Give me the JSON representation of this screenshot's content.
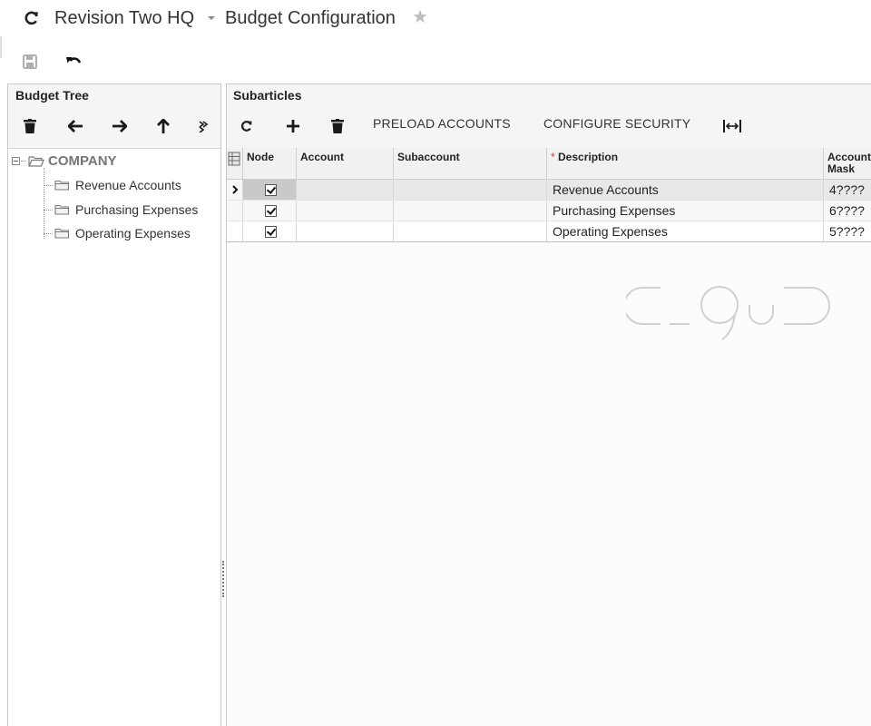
{
  "header": {
    "company": "Revision Two HQ",
    "screen_title": "Budget Configuration",
    "icons": [
      "refresh-icon",
      "dropdown-caret-icon",
      "star-icon",
      "save-icon",
      "undo-icon"
    ]
  },
  "budget_tree": {
    "title": "Budget Tree",
    "toolbar_icons": [
      "trash-icon",
      "arrow-left-icon",
      "arrow-right-icon",
      "arrow-up-icon",
      "more-icon"
    ],
    "root": "COMPANY",
    "children": [
      "Revenue Accounts",
      "Purchasing Expenses",
      "Operating Expenses"
    ]
  },
  "subarticles": {
    "title": "Subarticles",
    "toolbar": {
      "icons": [
        "refresh-icon",
        "add-icon",
        "trash-icon",
        "fit-columns-icon"
      ],
      "preload_label": "PRELOAD ACCOUNTS",
      "security_label": "CONFIGURE SECURITY"
    },
    "columns": {
      "node": "Node",
      "account": "Account",
      "subaccount": "Subaccount",
      "description_required": "*",
      "description": "Description",
      "account_mask": "Account Mask"
    },
    "rows": [
      {
        "node": true,
        "account": "",
        "subaccount": "",
        "description": "Revenue Accounts",
        "account_mask": "4????",
        "selected": true
      },
      {
        "node": true,
        "account": "",
        "subaccount": "",
        "description": "Purchasing Expenses",
        "account_mask": "6????",
        "selected": false
      },
      {
        "node": true,
        "account": "",
        "subaccount": "",
        "description": "Operating Expenses",
        "account_mask": "5????",
        "selected": false
      }
    ]
  },
  "colors": {
    "accent_required": "#e53935",
    "panel_header_bg": "#f5f5f5",
    "selected_row_bg": "#e8e8e8"
  }
}
